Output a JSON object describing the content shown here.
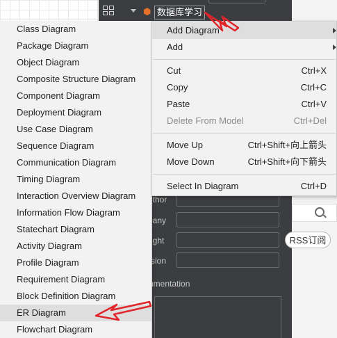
{
  "tree": {
    "model_name": "数据库学习",
    "model_icon": "cube-icon"
  },
  "properties": {
    "labels": [
      "uthor",
      "pany",
      "right",
      "rsion"
    ],
    "documentation_label": "umentation"
  },
  "right_page": {
    "rss_button": "RSS订阅",
    "search_icon": "search-icon"
  },
  "submenu": {
    "items": [
      "Class Diagram",
      "Package Diagram",
      "Object Diagram",
      "Composite Structure Diagram",
      "Component Diagram",
      "Deployment Diagram",
      "Use Case Diagram",
      "Sequence Diagram",
      "Communication Diagram",
      "Timing Diagram",
      "Interaction Overview Diagram",
      "Information Flow Diagram",
      "Statechart Diagram",
      "Activity Diagram",
      "Profile Diagram",
      "Requirement Diagram",
      "Block Definition Diagram",
      "ER Diagram",
      "Flowchart Diagram"
    ],
    "highlighted": "ER Diagram"
  },
  "context_menu": {
    "add_diagram": "Add Diagram",
    "add": "Add",
    "cut": {
      "label": "Cut",
      "shortcut": "Ctrl+X"
    },
    "copy": {
      "label": "Copy",
      "shortcut": "Ctrl+C"
    },
    "paste": {
      "label": "Paste",
      "shortcut": "Ctrl+V"
    },
    "delete": {
      "label": "Delete From Model",
      "shortcut": "Ctrl+Del"
    },
    "move_up": {
      "label": "Move Up",
      "shortcut": "Ctrl+Shift+向上箭头"
    },
    "move_down": {
      "label": "Move Down",
      "shortcut": "Ctrl+Shift+向下箭头"
    },
    "select": {
      "label": "Select In Diagram",
      "shortcut": "Ctrl+D"
    }
  },
  "annotations": {
    "arrow_color": "#e0252b"
  },
  "colors": {
    "panel_dark": "#3b3d40",
    "menu_bg": "#f2f2f2",
    "highlight": "#dedede"
  }
}
